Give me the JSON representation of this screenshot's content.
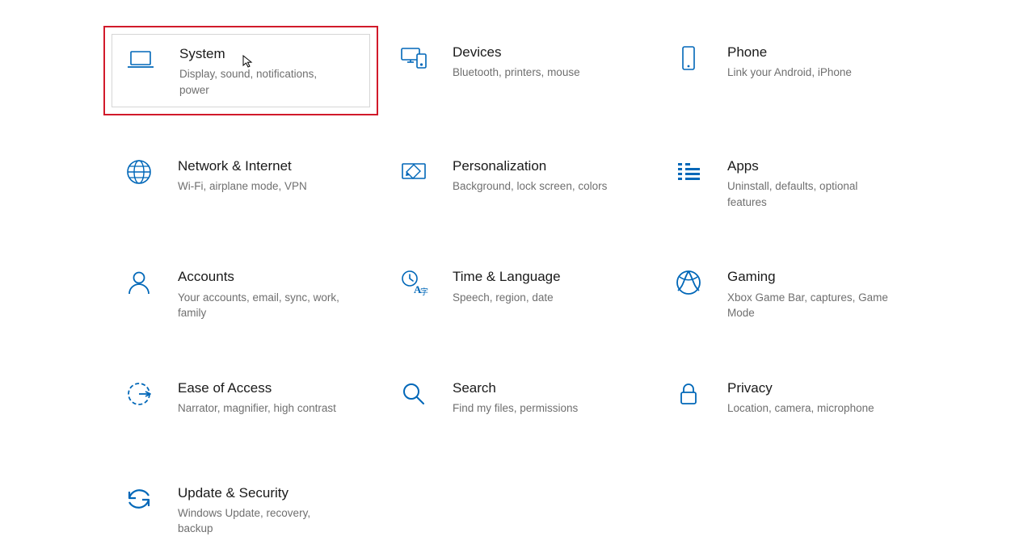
{
  "accent_color": "#0067b8",
  "highlight_color": "#d11a2a",
  "tiles": [
    {
      "id": "system",
      "title": "System",
      "desc": "Display, sound, notifications, power",
      "icon": "laptop-icon",
      "highlighted": true
    },
    {
      "id": "devices",
      "title": "Devices",
      "desc": "Bluetooth, printers, mouse",
      "icon": "devices-icon",
      "highlighted": false
    },
    {
      "id": "phone",
      "title": "Phone",
      "desc": "Link your Android, iPhone",
      "icon": "phone-icon",
      "highlighted": false
    },
    {
      "id": "network",
      "title": "Network & Internet",
      "desc": "Wi-Fi, airplane mode, VPN",
      "icon": "globe-icon",
      "highlighted": false
    },
    {
      "id": "personalization",
      "title": "Personalization",
      "desc": "Background, lock screen, colors",
      "icon": "personalization-icon",
      "highlighted": false
    },
    {
      "id": "apps",
      "title": "Apps",
      "desc": "Uninstall, defaults, optional features",
      "icon": "apps-icon",
      "highlighted": false
    },
    {
      "id": "accounts",
      "title": "Accounts",
      "desc": "Your accounts, email, sync, work, family",
      "icon": "accounts-icon",
      "highlighted": false
    },
    {
      "id": "time-language",
      "title": "Time & Language",
      "desc": "Speech, region, date",
      "icon": "time-language-icon",
      "highlighted": false
    },
    {
      "id": "gaming",
      "title": "Gaming",
      "desc": "Xbox Game Bar, captures, Game Mode",
      "icon": "gaming-icon",
      "highlighted": false
    },
    {
      "id": "ease-of-access",
      "title": "Ease of Access",
      "desc": "Narrator, magnifier, high contrast",
      "icon": "ease-of-access-icon",
      "highlighted": false
    },
    {
      "id": "search",
      "title": "Search",
      "desc": "Find my files, permissions",
      "icon": "search-icon",
      "highlighted": false
    },
    {
      "id": "privacy",
      "title": "Privacy",
      "desc": "Location, camera, microphone",
      "icon": "privacy-icon",
      "highlighted": false
    },
    {
      "id": "update-security",
      "title": "Update & Security",
      "desc": "Windows Update, recovery, backup",
      "icon": "update-icon",
      "highlighted": false
    }
  ]
}
